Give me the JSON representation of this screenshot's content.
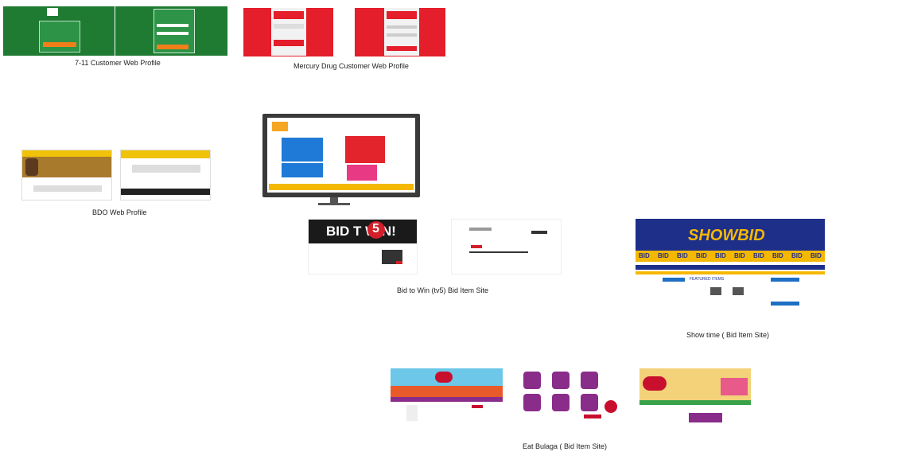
{
  "captions": {
    "seven_eleven": "7-11 Customer Web Profile",
    "mercury": "Mercury Drug Customer Web Profile",
    "bdo": "BDO Web Profile",
    "bid_to_win": "Bid to Win (tv5) Bid Item Site",
    "showtime": "Show time ( Bid Item Site)",
    "eat_bulaga": "Eat Bulaga ( Bid Item Site)"
  },
  "thumb_text": {
    "bid_to_win_banner": "BID T WIN!",
    "bid_to_win_five": "5",
    "showbid_logo": "SHOWBID",
    "showbid_featured": "FEATURED ITEMS",
    "bid_tags": [
      "BID",
      "BID",
      "BID",
      "BID",
      "BID",
      "BID",
      "BID",
      "BID",
      "BID",
      "BID"
    ]
  },
  "colors": {
    "seven_eleven_green": "#1f7a32",
    "mercury_red": "#e41e2a",
    "showtime_blue": "#1e2f8a",
    "showtime_gold": "#f5b800"
  }
}
